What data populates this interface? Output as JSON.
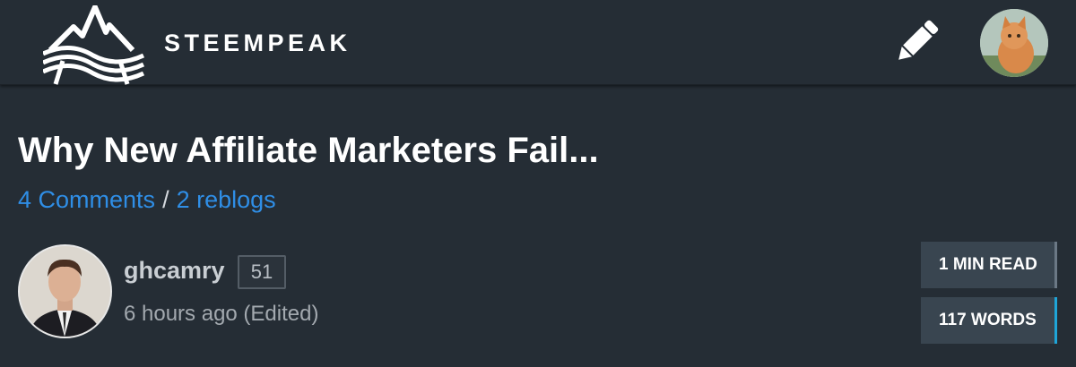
{
  "header": {
    "brand": "STEEMPEAK",
    "icons": {
      "logo": "mountain-wave-logo-icon",
      "write": "pencil-icon",
      "user": "user-avatar-kitten"
    }
  },
  "post": {
    "title": "Why New Affiliate Marketers Fail...",
    "comments_link": "4 Comments",
    "separator": "/",
    "reblogs_link": "2 reblogs",
    "author": {
      "name": "ghcamry",
      "reputation": "51",
      "timestamp": "6 hours ago (Edited)"
    },
    "stats": {
      "read_time": "1 MIN READ",
      "word_count": "117 WORDS"
    }
  },
  "colors": {
    "background": "#252d35",
    "link": "#2f8ee6",
    "stat_background": "#394550",
    "stat_accent": "#1fa5d8"
  }
}
